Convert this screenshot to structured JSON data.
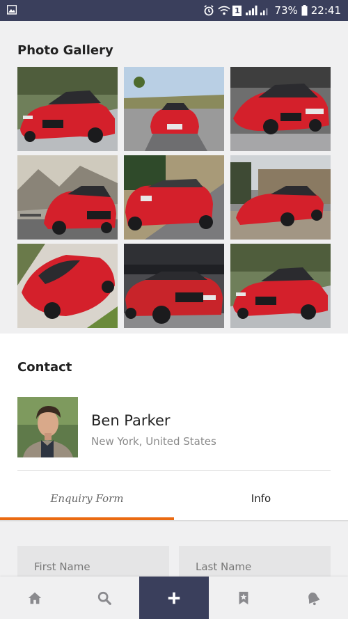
{
  "status_bar": {
    "battery": "73%",
    "time": "22:41",
    "sim_badge": "1"
  },
  "gallery": {
    "title": "Photo Gallery",
    "photos": [
      {
        "label": "red-audi-r8-front-road"
      },
      {
        "label": "red-audi-r8-country-road"
      },
      {
        "label": "red-audi-r8-motion"
      },
      {
        "label": "red-audi-r8-forest-road"
      },
      {
        "label": "red-audi-convertible-rear"
      },
      {
        "label": "red-audi-r8-cobblestone"
      },
      {
        "label": "red-audi-sedan-top"
      },
      {
        "label": "red-audi-r8-rear-bridge"
      },
      {
        "label": "red-audi-r8-front-road-2"
      }
    ]
  },
  "contact": {
    "title": "Contact",
    "name": "Ben Parker",
    "location": "New York, United States"
  },
  "tabs": {
    "enquiry_label": "Enquiry Form",
    "info_label": "Info",
    "active": "enquiry"
  },
  "form": {
    "first_name_placeholder": "First Name",
    "last_name_placeholder": "Last Name"
  },
  "bottom_nav": {
    "items": [
      "home-icon",
      "search-icon",
      "add-icon",
      "bookmark-icon",
      "bell-icon"
    ]
  },
  "colors": {
    "primary": "#3a3f5c",
    "accent": "#ea6a12",
    "car_red": "#d4202b"
  }
}
